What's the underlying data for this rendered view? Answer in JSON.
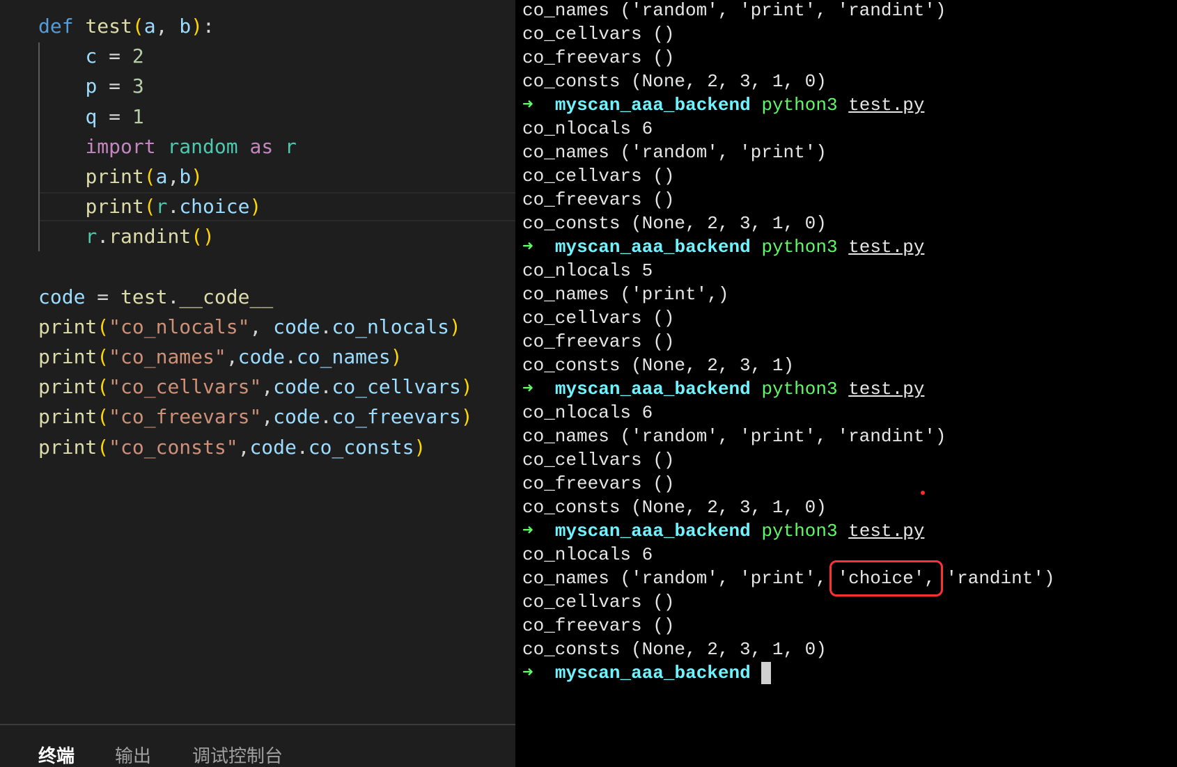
{
  "editor": {
    "code_lines": [
      "def test(a, b):",
      "    c = 2",
      "    p = 3",
      "    q = 1",
      "    import random as r",
      "    print(a,b)",
      "    print(r.choice)",
      "    r.randint()",
      "",
      "code = test.__code__",
      "print(\"co_nlocals\", code.co_nlocals)",
      "print(\"co_names\",code.co_names)",
      "print(\"co_cellvars\",code.co_cellvars)",
      "print(\"co_freevars\",code.co_freevars)",
      "print(\"co_consts\",code.co_consts)"
    ],
    "panel_tabs": [
      "终端",
      "输出",
      "调试控制台"
    ],
    "active_tab": "终端"
  },
  "terminal": {
    "prompt_arrow": "➜",
    "prompt_dir": "myscan_aaa_backend",
    "command": "python3",
    "command_arg": "test.py",
    "lines": [
      {
        "type": "output",
        "text": "co_names ('random', 'print', 'randint')"
      },
      {
        "type": "output",
        "text": "co_cellvars ()"
      },
      {
        "type": "output",
        "text": "co_freevars ()"
      },
      {
        "type": "output",
        "text": "co_consts (None, 2, 3, 1, 0)"
      },
      {
        "type": "prompt"
      },
      {
        "type": "output",
        "text": "co_nlocals 6"
      },
      {
        "type": "output",
        "text": "co_names ('random', 'print')"
      },
      {
        "type": "output",
        "text": "co_cellvars ()"
      },
      {
        "type": "output",
        "text": "co_freevars ()"
      },
      {
        "type": "output",
        "text": "co_consts (None, 2, 3, 1, 0)"
      },
      {
        "type": "prompt"
      },
      {
        "type": "output",
        "text": "co_nlocals 5"
      },
      {
        "type": "output",
        "text": "co_names ('print',)"
      },
      {
        "type": "output",
        "text": "co_cellvars ()"
      },
      {
        "type": "output",
        "text": "co_freevars ()"
      },
      {
        "type": "output",
        "text": "co_consts (None, 2, 3, 1)"
      },
      {
        "type": "prompt"
      },
      {
        "type": "output",
        "text": "co_nlocals 6"
      },
      {
        "type": "output",
        "text": "co_names ('random', 'print', 'randint')"
      },
      {
        "type": "output",
        "text": "co_cellvars ()"
      },
      {
        "type": "output",
        "text": "co_freevars ()"
      },
      {
        "type": "output",
        "text": "co_consts (None, 2, 3, 1, 0)"
      },
      {
        "type": "prompt"
      },
      {
        "type": "output",
        "text": "co_nlocals 6"
      },
      {
        "type": "highlight",
        "before": "co_names ('random', 'print', ",
        "highlight": "'choice',",
        "after": " 'randint')"
      },
      {
        "type": "output",
        "text": "co_cellvars ()"
      },
      {
        "type": "output",
        "text": "co_freevars ()"
      },
      {
        "type": "output",
        "text": "co_consts (None, 2, 3, 1, 0)"
      },
      {
        "type": "final_prompt"
      }
    ]
  },
  "colors": {
    "editor_bg": "#1e1e1e",
    "terminal_bg": "#000000",
    "prompt_arrow": "#5ff967",
    "prompt_dir": "#6ff3ff",
    "highlight_box": "#ff3030"
  }
}
